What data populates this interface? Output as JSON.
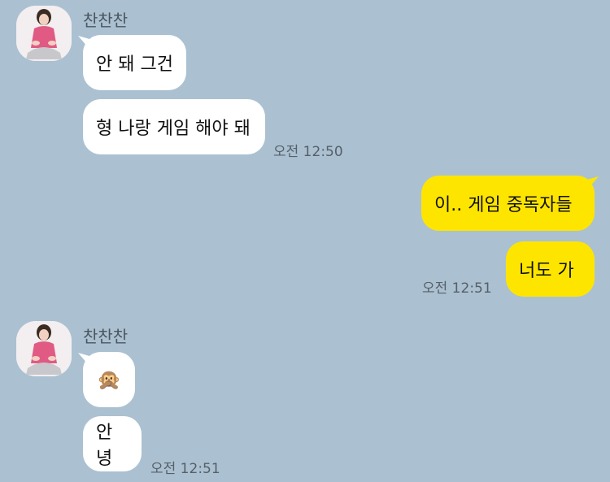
{
  "messages": [
    {
      "sender": "찬찬찬",
      "texts": [
        "안 돼 그건",
        "형 나랑 게임 해야 돼"
      ],
      "time": "오전 12:50"
    },
    {
      "texts": [
        "이.. 게임 중독자들",
        "너도 가"
      ],
      "time": "오전 12:51"
    },
    {
      "sender": "찬찬찬",
      "texts": [
        "🙊",
        "안녕"
      ],
      "time": "오전 12:51"
    }
  ],
  "colors": {
    "background": "#abc1d1",
    "incoming_bubble": "#ffffff",
    "outgoing_bubble": "#fee500"
  },
  "icons": {
    "avatar": "profile-photo",
    "emoji": "see-no-evil-monkey"
  }
}
